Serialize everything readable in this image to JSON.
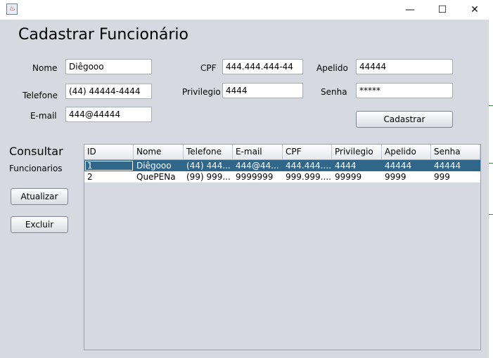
{
  "window": {
    "minimize_glyph": "—",
    "maximize_glyph": "☐",
    "close_glyph": "✕"
  },
  "form": {
    "title": "Cadastrar Funcionário",
    "fields": {
      "nome_label": "Nome",
      "nome_value": "Diêgooo",
      "cpf_label": "CPF",
      "cpf_value": "444.444.444-44",
      "apelido_label": "Apelido",
      "apelido_value": "44444",
      "telefone_label": "Telefone",
      "telefone_value": "(44) 44444-4444",
      "privilegio_label": "Privilegio",
      "privilegio_value": "4444",
      "senha_label": "Senha",
      "senha_value": "*****",
      "email_label": "E-mail",
      "email_value": "444@44444"
    },
    "cadastrar_label": "Cadastrar"
  },
  "sidebar": {
    "consultar_label": "Consultar",
    "funcionarios_label": "Funcionarios",
    "atualizar_label": "Atualizar",
    "excluir_label": "Excluir"
  },
  "table": {
    "columns": [
      "ID",
      "Nome",
      "Telefone",
      "E-mail",
      "CPF",
      "Privilegio",
      "Apelido",
      "Senha"
    ],
    "rows": [
      [
        "1",
        "Diêgooo",
        "(44) 444...",
        "444@44...",
        "444.444....",
        "4444",
        "44444",
        "44444"
      ],
      [
        "2",
        "QuePENa",
        "(99) 999...",
        "9999999",
        "999.999....",
        "99999",
        "9999",
        "999"
      ]
    ],
    "selected_row": 0
  },
  "colors": {
    "background": "#d6d9df",
    "selection": "#2f6689"
  },
  "icons": {
    "app": "java-icon",
    "minimize": "minimize-icon",
    "maximize": "maximize-icon",
    "close": "close-icon"
  }
}
